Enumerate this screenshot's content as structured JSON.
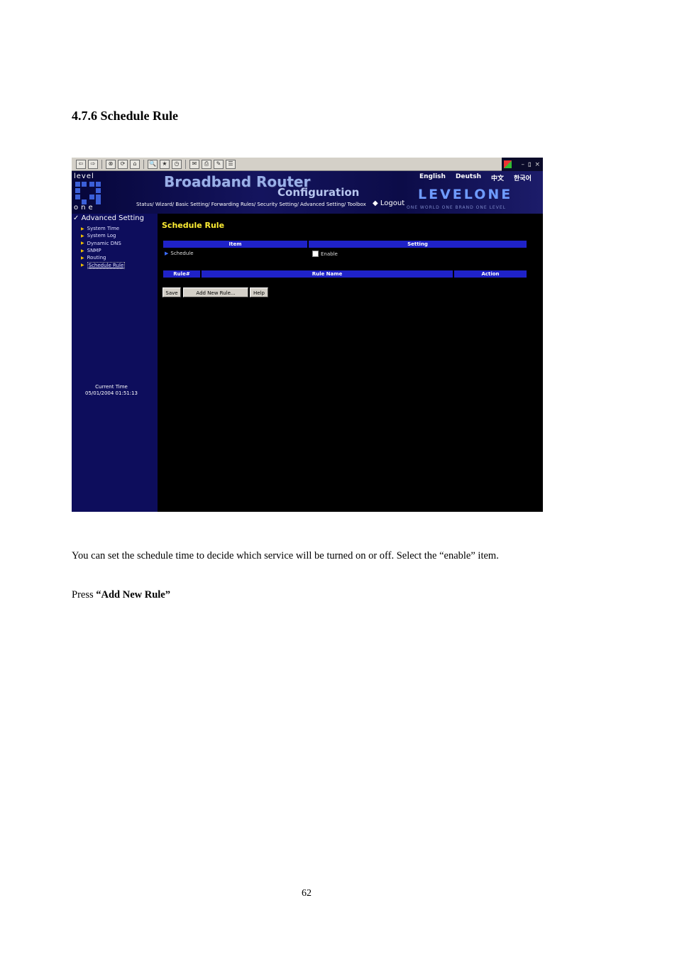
{
  "section_heading": "4.7.6 Schedule Rule",
  "screenshot": {
    "toolbar": {
      "buttons": [
        "⇦",
        "⇨",
        "⊗",
        "⟳",
        "⌂",
        "🔍",
        "★",
        "◷",
        "✉",
        "⎙",
        "✎",
        "☰"
      ]
    },
    "window_controls": {
      "minimize": "–",
      "restore": "ﾛ",
      "close": "×"
    },
    "header": {
      "logo_top": "level",
      "logo_bottom": "one",
      "title": "Broadband Router",
      "subtitle": "Configuration",
      "languages": [
        "English",
        "Deutsh",
        "中文",
        "한국어"
      ],
      "brandmark": "LEVELONE",
      "tagline": "ONE WORLD  ONE BRAND  ONE LEVEL",
      "nav": "Status/ Wizard/ Basic Setting/ Forwarding Rules/ Security Setting/ Advanced Setting/ Toolbox",
      "logout": "Logout"
    },
    "sidebar": {
      "title": "Advanced Setting",
      "items": [
        {
          "label": "System Time"
        },
        {
          "label": "System Log"
        },
        {
          "label": "Dynamic DNS"
        },
        {
          "label": "SNMP"
        },
        {
          "label": "Routing"
        },
        {
          "label": "Schedule Rule"
        }
      ],
      "clock_label": "Current Time",
      "clock_value": "05/01/2004 01:51:13"
    },
    "main": {
      "title": "Schedule Rule",
      "settings_table": {
        "headers": [
          "Item",
          "Setting"
        ],
        "row_item": "Schedule",
        "row_setting": "Enable"
      },
      "rules_table": {
        "headers": [
          "Rule#",
          "Rule Name",
          "Action"
        ]
      },
      "buttons": {
        "save": "Save",
        "add": "Add New Rule...",
        "help": "Help"
      }
    }
  },
  "body": {
    "paragraph": "You can set the schedule time to decide which service will be turned on or off. Select the “enable” item.",
    "press_prefix": "Press ",
    "press_bold": "“Add New Rule”"
  },
  "page_number": "62"
}
